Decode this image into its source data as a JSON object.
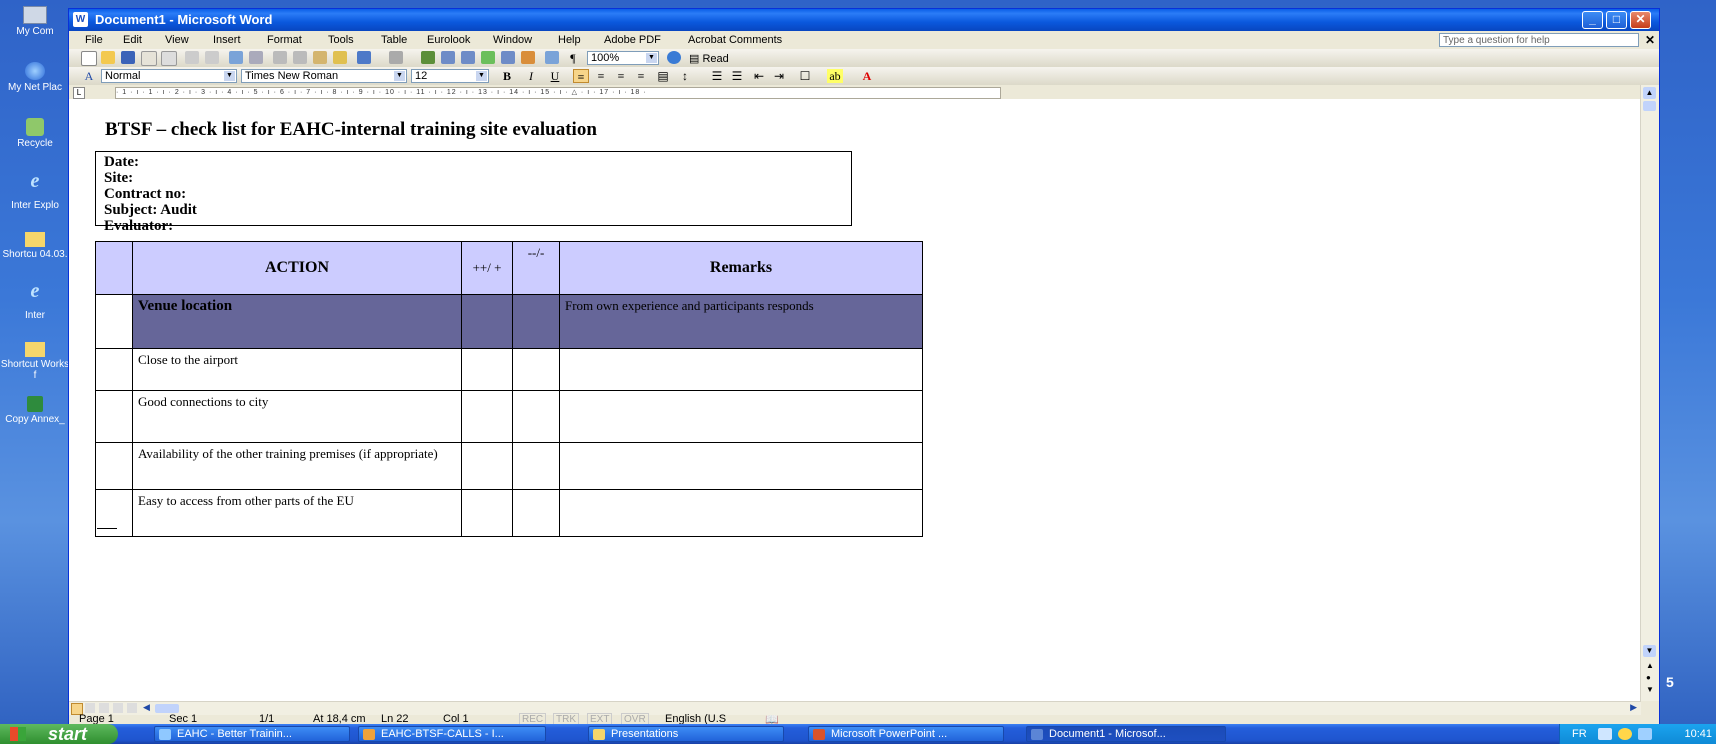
{
  "desktop": {
    "icons": [
      {
        "label": "My Com",
        "name": "my-computer"
      },
      {
        "label": "My Net Plac",
        "name": "my-network-places"
      },
      {
        "label": "Recycle",
        "name": "recycle-bin"
      },
      {
        "label": "Inter Explo",
        "name": "internet-explorer"
      },
      {
        "label": "Shortcu 04.03.",
        "name": "shortcut-1"
      },
      {
        "label": "Inter",
        "name": "internet"
      },
      {
        "label": "Shortcut Works f",
        "name": "shortcut-works"
      },
      {
        "label": "Copy Annex_",
        "name": "copy-annex"
      }
    ]
  },
  "window": {
    "title": "Document1 - Microsoft Word",
    "menu": [
      "File",
      "Edit",
      "View",
      "Insert",
      "Format",
      "Tools",
      "Table",
      "Eurolook",
      "Window",
      "Help",
      "Adobe PDF",
      "Acrobat Comments"
    ],
    "help_placeholder": "Type a question for help",
    "zoom": "100%",
    "read_label": "Read",
    "style": "Normal",
    "font": "Times New Roman",
    "size": "12"
  },
  "ruler": {
    "text": "· 1 · ı · 1 · ı · 2 · ı · 3 · ı · 4 · ı · 5 · ı · 6 · ı · 7 · ı · 8 · ı · 9 · ı · 10 · ı · 11 · ı · 12 · ı · 13 · ı · 14 · ı · 15 · ı · △ · ı · 17 · ı · 18 ·"
  },
  "document": {
    "title": "BTSF – check list for EAHC-internal training site evaluation",
    "info": [
      "Date:",
      "Site:",
      "Contract no:",
      "Subject: Audit",
      "Evaluator:"
    ],
    "table": {
      "headers": {
        "action": "ACTION",
        "plus": "++/ +",
        "minus": "--/-",
        "remarks": "Remarks"
      },
      "rows": [
        {
          "action": "Venue location",
          "remarks": "From own experience and participants responds"
        },
        {
          "action": "Close to the airport",
          "remarks": ""
        },
        {
          "action": "Good connections to city",
          "remarks": ""
        },
        {
          "action": "Availability of the other training premises (if appropriate)",
          "remarks": ""
        },
        {
          "action": "Easy to access from other parts of the EU",
          "remarks": ""
        }
      ]
    }
  },
  "status": {
    "page": "Page 1",
    "sec": "Sec 1",
    "pages": "1/1",
    "at": "At 18,4 cm",
    "ln": "Ln 22",
    "col": "Col 1",
    "rec": "REC",
    "trk": "TRK",
    "ext": "EXT",
    "ovr": "OVR",
    "lang": "English (U.S"
  },
  "taskbar": {
    "start": "start",
    "tasks": [
      "EAHC - Better Trainin...",
      "EAHC-BTSF-CALLS - I...",
      "Presentations",
      "Microsoft PowerPoint ...",
      "Document1 - Microsof..."
    ],
    "tray_lang": "FR",
    "clock": "10:41"
  }
}
